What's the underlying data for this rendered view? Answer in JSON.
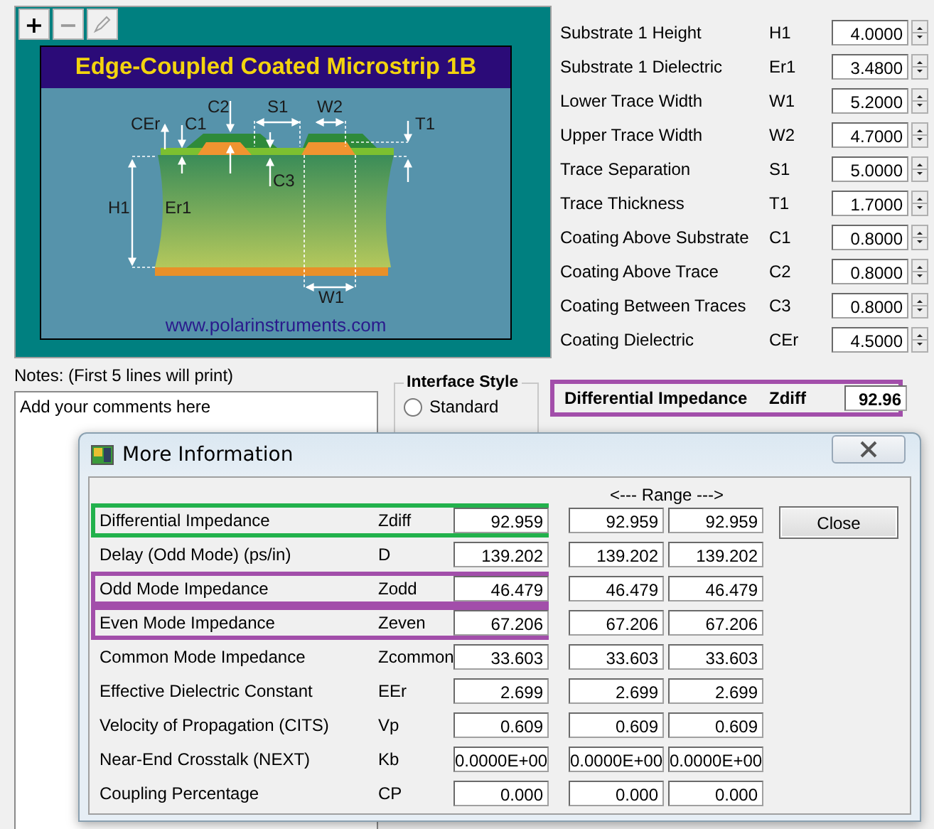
{
  "toolbar": [
    {
      "kind": "text",
      "label": "+",
      "disabled": false
    },
    {
      "kind": "text",
      "label": "−",
      "disabled": true
    },
    {
      "kind": "pen",
      "disabled": true
    }
  ],
  "diagram": {
    "title": "Edge-Coupled Coated Microstrip 1B",
    "labels": [
      "CEr",
      "C1",
      "C2",
      "S1",
      "W2",
      "T1",
      "H1",
      "Er1",
      "C3",
      "W1"
    ],
    "url": "www.polarinstruments.com"
  },
  "parameters": [
    {
      "name": "Substrate 1 Height",
      "symbol": "H1",
      "value": "4.0000"
    },
    {
      "name": "Substrate 1 Dielectric",
      "symbol": "Er1",
      "value": "3.4800"
    },
    {
      "name": "Lower Trace Width",
      "symbol": "W1",
      "value": "5.2000"
    },
    {
      "name": "Upper Trace Width",
      "symbol": "W2",
      "value": "4.7000"
    },
    {
      "name": "Trace Separation",
      "symbol": "S1",
      "value": "5.0000"
    },
    {
      "name": "Trace Thickness",
      "symbol": "T1",
      "value": "1.7000"
    },
    {
      "name": "Coating Above Substrate",
      "symbol": "C1",
      "value": "0.8000"
    },
    {
      "name": "Coating Above Trace",
      "symbol": "C2",
      "value": "0.8000"
    },
    {
      "name": "Coating Between Traces",
      "symbol": "C3",
      "value": "0.8000"
    },
    {
      "name": "Coating Dielectric",
      "symbol": "CEr",
      "value": "4.5000"
    }
  ],
  "notes": {
    "label": "Notes: (First 5 lines will print)",
    "value": "Add your comments here"
  },
  "interface_style": {
    "title": "Interface Style",
    "options": [
      {
        "label": "Standard",
        "selected": false
      }
    ]
  },
  "result": {
    "name": "Differential Impedance",
    "symbol": "Zdiff",
    "value": "92.96",
    "color": "#a24eaa"
  },
  "dialog": {
    "title": "More Information",
    "range_label": "<--- Range --->",
    "close_button": "Close",
    "rows": [
      {
        "name": "Differential Impedance",
        "symbol": "Zdiff",
        "value": "92.959",
        "range_low": "92.959",
        "range_high": "92.959",
        "color": "#22b14c"
      },
      {
        "name": "Delay (Odd Mode) (ps/in)",
        "symbol": "D",
        "value": "139.202",
        "range_low": "139.202",
        "range_high": "139.202"
      },
      {
        "name": "Odd Mode Impedance",
        "symbol": "Zodd",
        "value": "46.479",
        "range_low": "46.479",
        "range_high": "46.479",
        "color": "#a24eaa"
      },
      {
        "name": "Even Mode Impedance",
        "symbol": "Zeven",
        "value": "67.206",
        "range_low": "67.206",
        "range_high": "67.206",
        "color": "#a24eaa"
      },
      {
        "name": "Common Mode Impedance",
        "symbol": "Zcommon",
        "value": "33.603",
        "range_low": "33.603",
        "range_high": "33.603"
      },
      {
        "name": "Effective Dielectric Constant",
        "symbol": "EEr",
        "value": "2.699",
        "range_low": "2.699",
        "range_high": "2.699"
      },
      {
        "name": "Velocity of Propagation (CITS)",
        "symbol": "Vp",
        "value": "0.609",
        "range_low": "0.609",
        "range_high": "0.609"
      },
      {
        "name": "Near-End Crosstalk (NEXT)",
        "symbol": "Kb",
        "value": "0.0000E+00",
        "range_low": "0.0000E+00",
        "range_high": "0.0000E+00"
      },
      {
        "name": "Coupling Percentage",
        "symbol": "CP",
        "value": "0.000",
        "range_low": "0.000",
        "range_high": "0.000"
      }
    ]
  }
}
